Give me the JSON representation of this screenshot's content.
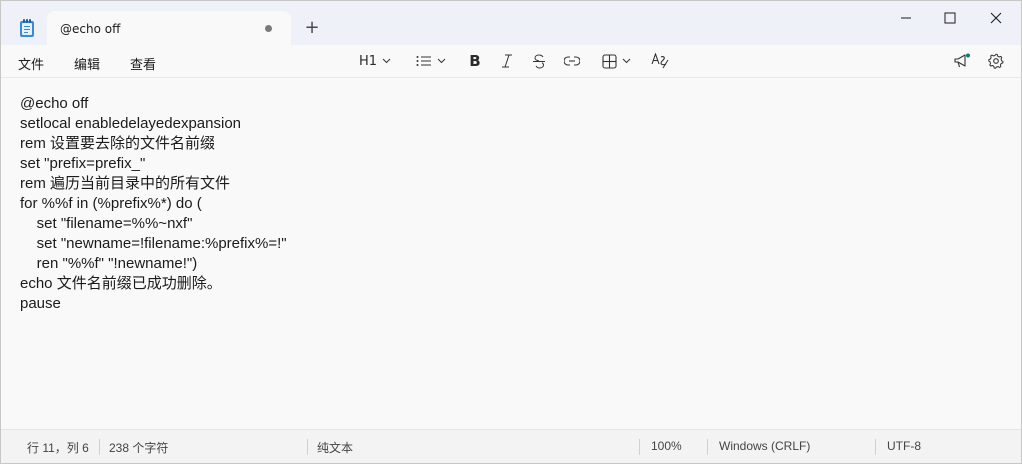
{
  "tab": {
    "title": "@echo off"
  },
  "window_controls": {
    "new_tab": "+"
  },
  "menu": {
    "file": "文件",
    "edit": "编辑",
    "view": "查看"
  },
  "toolbar": {
    "heading": "H1",
    "bold": "B"
  },
  "editor": {
    "lines": [
      "@echo off",
      "setlocal enabledelayedexpansion",
      "rem 设置要去除的文件名前缀",
      "set \"prefix=prefix_\"",
      "rem 遍历当前目录中的所有文件",
      "for %%f in (%prefix%*) do (",
      "    set \"filename=%%~nxf\"",
      "    set \"newname=!filename:%prefix%=!\"",
      "    ren \"%%f\" \"!newname!\")",
      "echo 文件名前缀已成功删除。",
      "pause"
    ]
  },
  "status": {
    "position": "行 11，列 6",
    "char_count": "238 个字符",
    "format": "纯文本",
    "zoom": "100%",
    "line_ending": "Windows (CRLF)",
    "encoding": "UTF-8"
  },
  "icons": {
    "app": "notepad-icon",
    "unsaved": "unsaved-dot-icon",
    "list": "bullet-list-icon",
    "italic": "italic-icon",
    "strike": "strikethrough-icon",
    "link": "link-icon",
    "table": "table-icon",
    "spell": "spellcheck-icon",
    "announce": "megaphone-icon",
    "settings": "gear-icon"
  },
  "colors": {
    "titlebar": "#eef2f8",
    "editor_bg": "#f9f9f9",
    "notification_dot": "#0f7b6c"
  }
}
